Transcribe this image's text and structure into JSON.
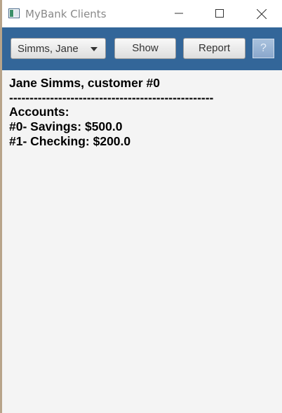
{
  "window": {
    "title": "MyBank Clients"
  },
  "toolbar": {
    "client_select_value": "Simms, Jane",
    "show_label": "Show",
    "report_label": "Report",
    "help_label": "?"
  },
  "report": {
    "heading": "Jane Simms, customer #0",
    "separator": "--------------------------------------------------",
    "accounts_label": "Accounts:",
    "accounts": [
      "#0- Savings: $500.0",
      "#1- Checking: $200.0"
    ]
  },
  "colors": {
    "toolbar_bg": "#336699",
    "content_bg": "#f4f4f4",
    "help_button": "#8aa8cc"
  },
  "icons": {
    "app": "app-window-icon",
    "minimize": "minimize-icon",
    "maximize": "maximize-icon",
    "close": "close-icon",
    "dropdown": "chevron-down-icon"
  }
}
